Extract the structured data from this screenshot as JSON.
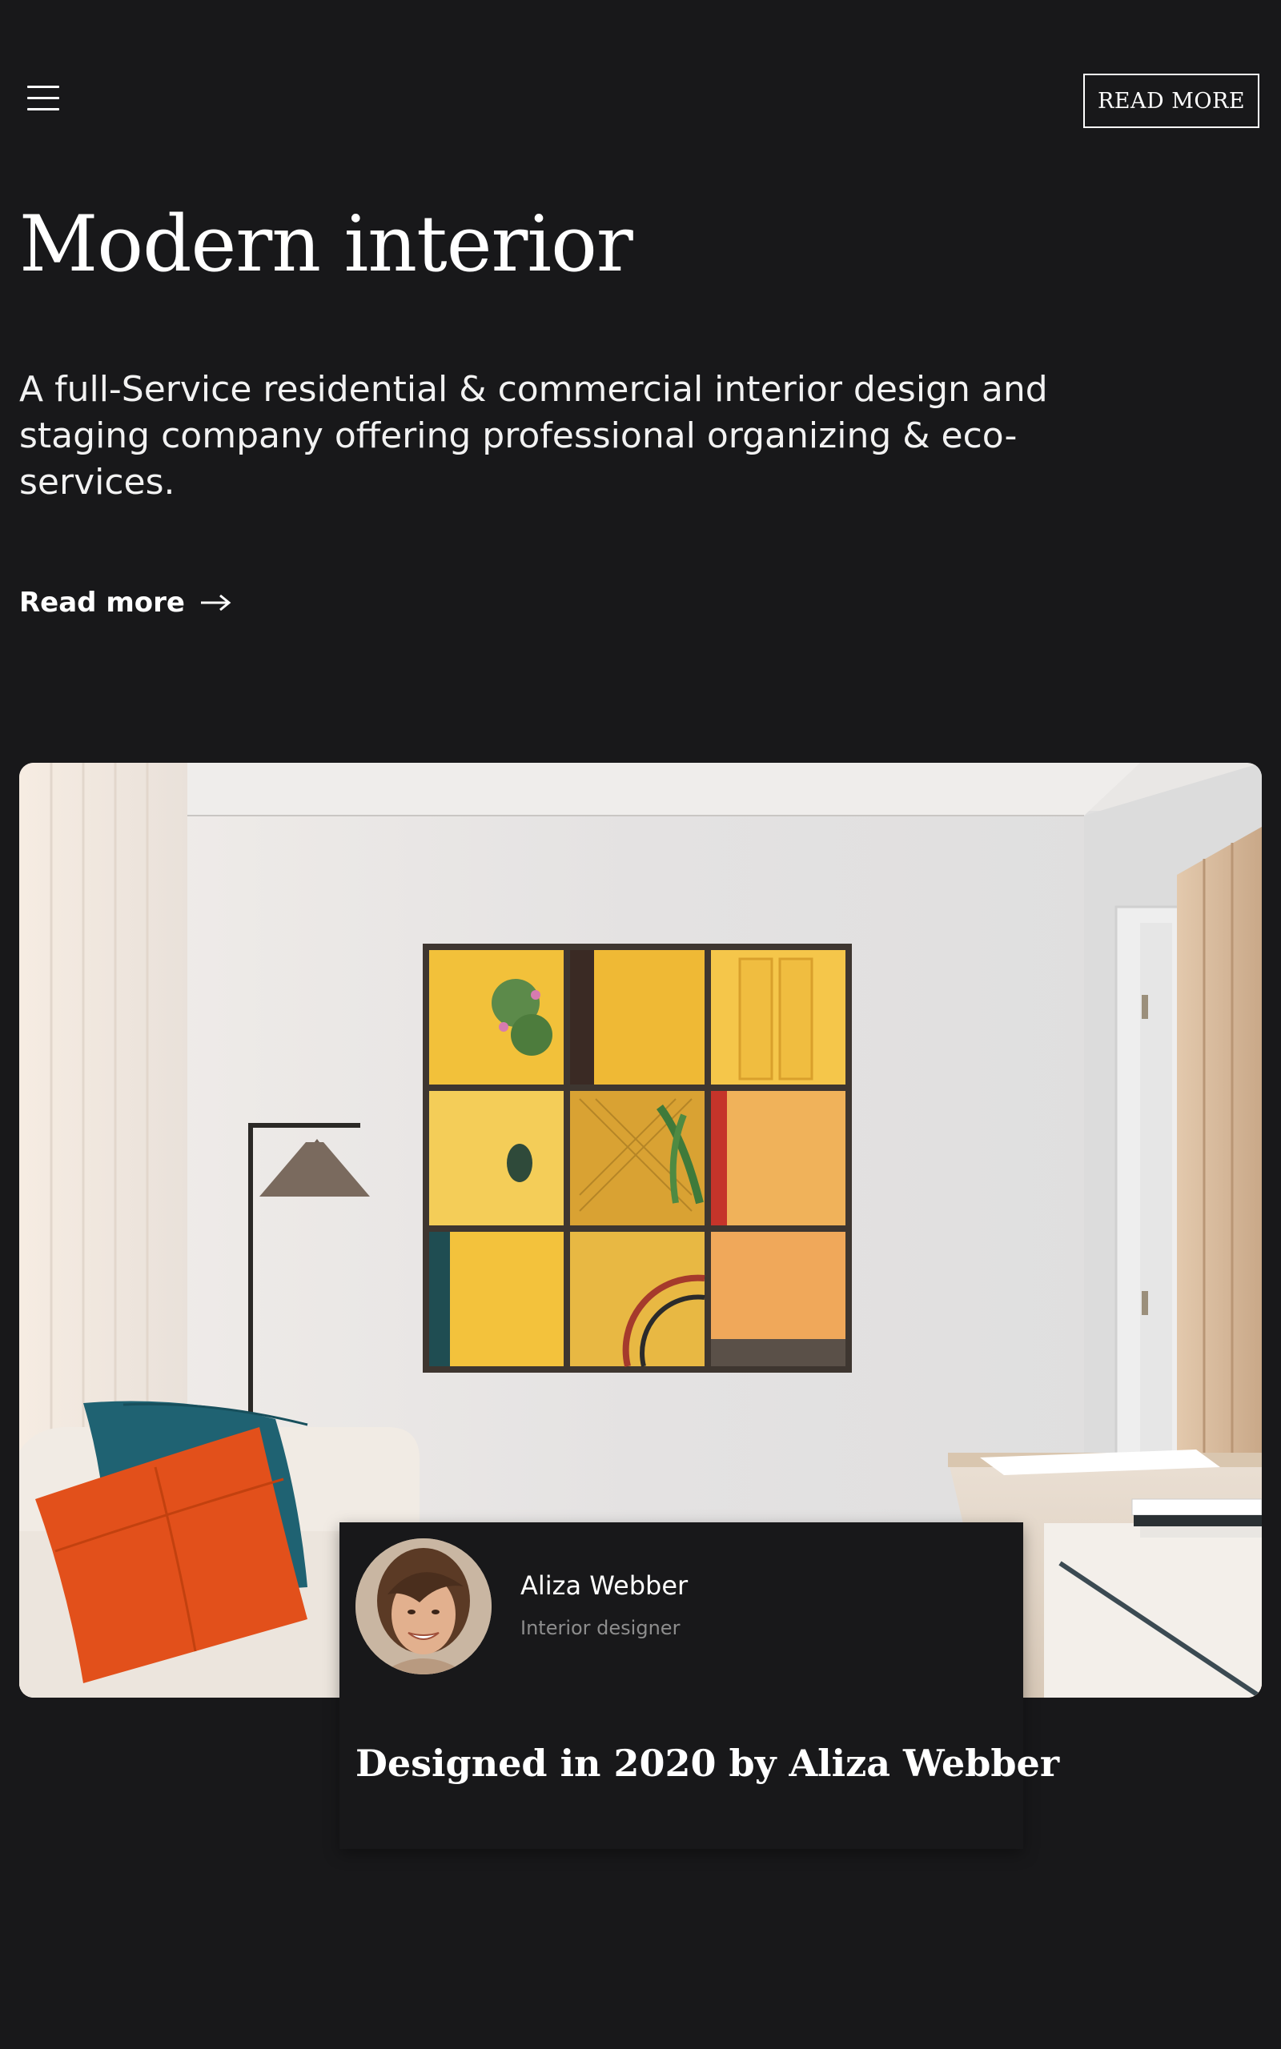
{
  "header": {
    "menu_icon": "hamburger-menu-icon",
    "read_more_button": "READ MORE"
  },
  "hero": {
    "title": "Modern interior",
    "description": "A full-Service residential & commercial interior design and staging company offering professional organizing & eco-services.",
    "link_label": "Read more",
    "link_icon": "arrow-right-icon"
  },
  "image": {
    "subject": "living-room-photo"
  },
  "designer": {
    "name": "Aliza Webber",
    "role": "Interior designer",
    "caption": "Designed in 2020 by Aliza Webber"
  },
  "colors": {
    "background": "#18181a",
    "text": "#ffffff",
    "muted": "#8d8d8d"
  }
}
